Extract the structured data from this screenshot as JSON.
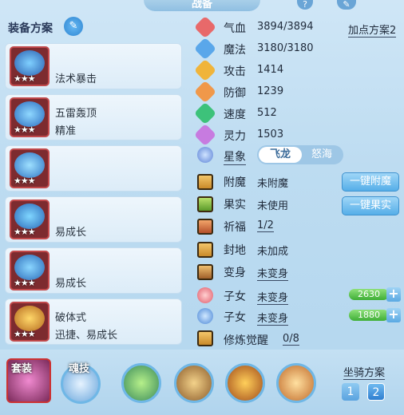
{
  "header": {
    "title": "战备",
    "help_icon": "?"
  },
  "left": {
    "title": "装备方案",
    "items": [
      {
        "line1": "",
        "line2": "法术暴击",
        "stars": "★★★"
      },
      {
        "line1": "五雷轰顶",
        "line2": "精准",
        "stars": "★★★"
      },
      {
        "line1": "",
        "line2": "",
        "stars": "★★★"
      },
      {
        "line1": "",
        "line2": "易成长",
        "stars": "★★★"
      },
      {
        "line1": "",
        "line2": "易成长",
        "stars": "★★★"
      },
      {
        "line1": "破体式",
        "line2": "迅捷、易成长",
        "stars": "★★★"
      }
    ]
  },
  "stats": {
    "add_point_plan": "加点方案2",
    "rows": [
      {
        "label": "气血",
        "value": "3894/3894"
      },
      {
        "label": "魔法",
        "value": "3180/3180"
      },
      {
        "label": "攻击",
        "value": "1414"
      },
      {
        "label": "防御",
        "value": "1239"
      },
      {
        "label": "速度",
        "value": "512"
      },
      {
        "label": "灵力",
        "value": "1503"
      }
    ],
    "xingxiang": {
      "label": "星象",
      "on": "飞龙",
      "off": "怒海"
    },
    "extra": [
      {
        "label": "附魔",
        "value": "未附魔",
        "button": "一键附魔"
      },
      {
        "label": "果实",
        "value": "未使用",
        "button": "一键果实"
      },
      {
        "label": "祈福",
        "value": "1/2"
      },
      {
        "label": "封地",
        "value": "未加成"
      },
      {
        "label": "变身",
        "value": "未变身"
      },
      {
        "label": "子女",
        "value": "未变身",
        "bar": "2630"
      },
      {
        "label": "子女",
        "value": "未变身",
        "bar": "1880"
      },
      {
        "label": "修炼觉醒",
        "value": "0/8"
      }
    ],
    "plus": "+"
  },
  "bottom": {
    "tab_equip": "套装",
    "tab_skill": "魂技",
    "mount_plan": "坐骑方案",
    "mount_buttons": [
      "1",
      "2"
    ]
  },
  "colors": {
    "accent": "#3f92cf",
    "progress": "#4db43f"
  }
}
